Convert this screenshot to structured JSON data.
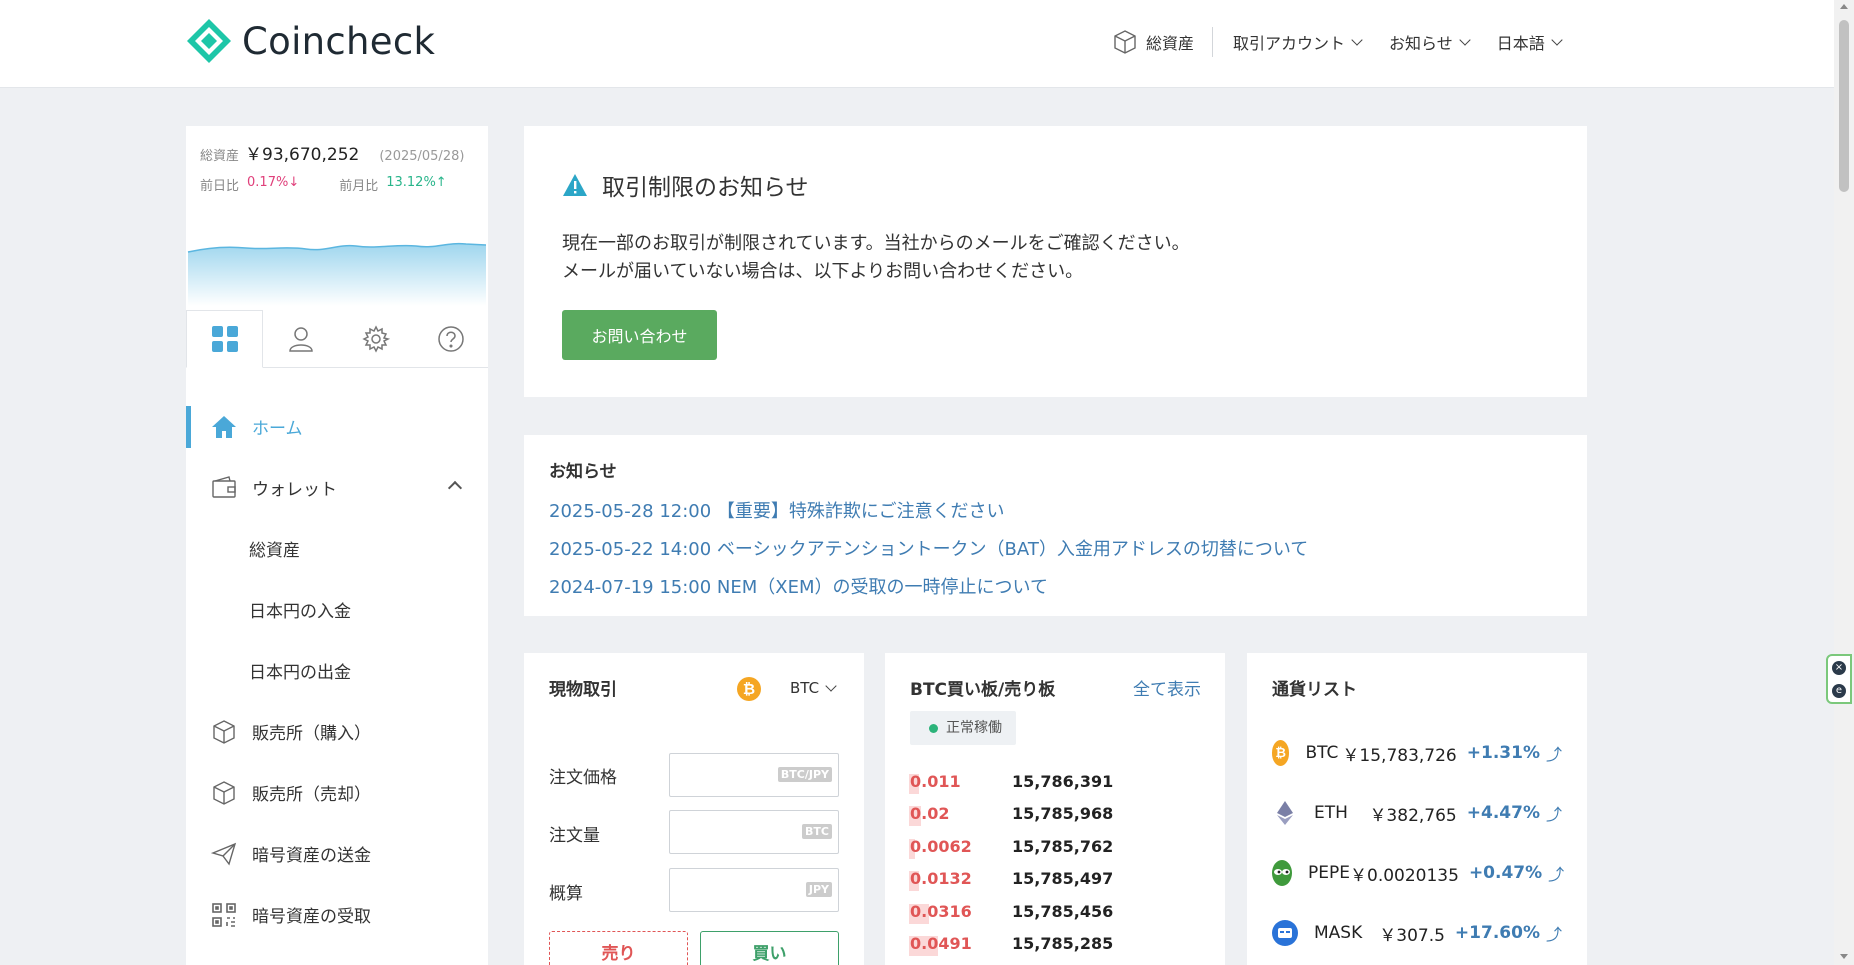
{
  "header": {
    "brand": "Coincheck",
    "nav": {
      "assets": "総資産",
      "account": "取引アカウント",
      "news": "お知らせ",
      "language": "日本語"
    }
  },
  "sidebar": {
    "summary": {
      "label": "総資産",
      "amount": "￥93,670,252",
      "date": "(2025/05/28)",
      "day_label": "前日比",
      "day_change": "0.17%↓",
      "month_label": "前月比",
      "month_change": "13.12%↑"
    },
    "tabs": [
      "dashboard",
      "account",
      "settings",
      "help"
    ],
    "menu": [
      {
        "label": "ホーム"
      },
      {
        "label": "ウォレット"
      },
      {
        "label": "総資産"
      },
      {
        "label": "日本円の入金"
      },
      {
        "label": "日本円の出金"
      },
      {
        "label": "販売所（購入）"
      },
      {
        "label": "販売所（売却）"
      },
      {
        "label": "暗号資産の送金"
      },
      {
        "label": "暗号資産の受取"
      }
    ]
  },
  "notice": {
    "title": "取引制限のお知らせ",
    "line1": "現在一部のお取引が制限されています。当社からのメールをご確認ください。",
    "line2": "メールが届いていない場合は、以下よりお問い合わせください。",
    "button": "お問い合わせ"
  },
  "news": {
    "title": "お知らせ",
    "items": [
      "2025-05-28 12:00 【重要】特殊詐欺にご注意ください",
      "2025-05-22 14:00 ベーシックアテンショントークン（BAT）入金用アドレスの切替について",
      "2024-07-19 15:00 NEM（XEM）の受取の一時停止について"
    ]
  },
  "trade": {
    "title": "現物取引",
    "pair": "BTC",
    "price_label": "注文価格",
    "price_unit": "BTC/JPY",
    "amount_label": "注文量",
    "amount_unit": "BTC",
    "estimate_label": "概算",
    "estimate_unit": "JPY",
    "sell": "売り",
    "buy": "買い"
  },
  "orderbook": {
    "title": "BTC買い板/売り板",
    "show_all": "全て表示",
    "status": "正常稼働",
    "rows": [
      {
        "qty": "0.011",
        "price": "15,786,391",
        "depth": 0.1
      },
      {
        "qty": "0.02",
        "price": "15,785,968",
        "depth": 0.12
      },
      {
        "qty": "0.0062",
        "price": "15,785,762",
        "depth": 0.06
      },
      {
        "qty": "0.0132",
        "price": "15,785,497",
        "depth": 0.1
      },
      {
        "qty": "0.0316",
        "price": "15,785,456",
        "depth": 0.2
      },
      {
        "qty": "0.0491",
        "price": "15,785,285",
        "depth": 0.28
      }
    ]
  },
  "coins": {
    "title": "通貨リスト",
    "items": [
      {
        "symbol": "BTC",
        "price": "￥15,783,726",
        "change": "+1.31%",
        "color": "#f5a623",
        "icon": "bitcoin-icon"
      },
      {
        "symbol": "ETH",
        "price": "￥382,765",
        "change": "+4.47%",
        "color": "#7a7fa6",
        "icon": "ethereum-icon"
      },
      {
        "symbol": "PEPE",
        "price": "￥0.0020135",
        "change": "+0.47%",
        "color": "#3f9a3c",
        "icon": "pepe-icon"
      },
      {
        "symbol": "MASK",
        "price": "￥307.5",
        "change": "+17.60%",
        "color": "#2a73d8",
        "icon": "mask-icon"
      }
    ]
  },
  "colors": {
    "accent": "#4aa8d8",
    "brand": "#1ec6a8",
    "contact_button": "#5aaa5f",
    "link": "#3f7cb2",
    "sell": "#e05656",
    "buy": "#3ea06a"
  }
}
